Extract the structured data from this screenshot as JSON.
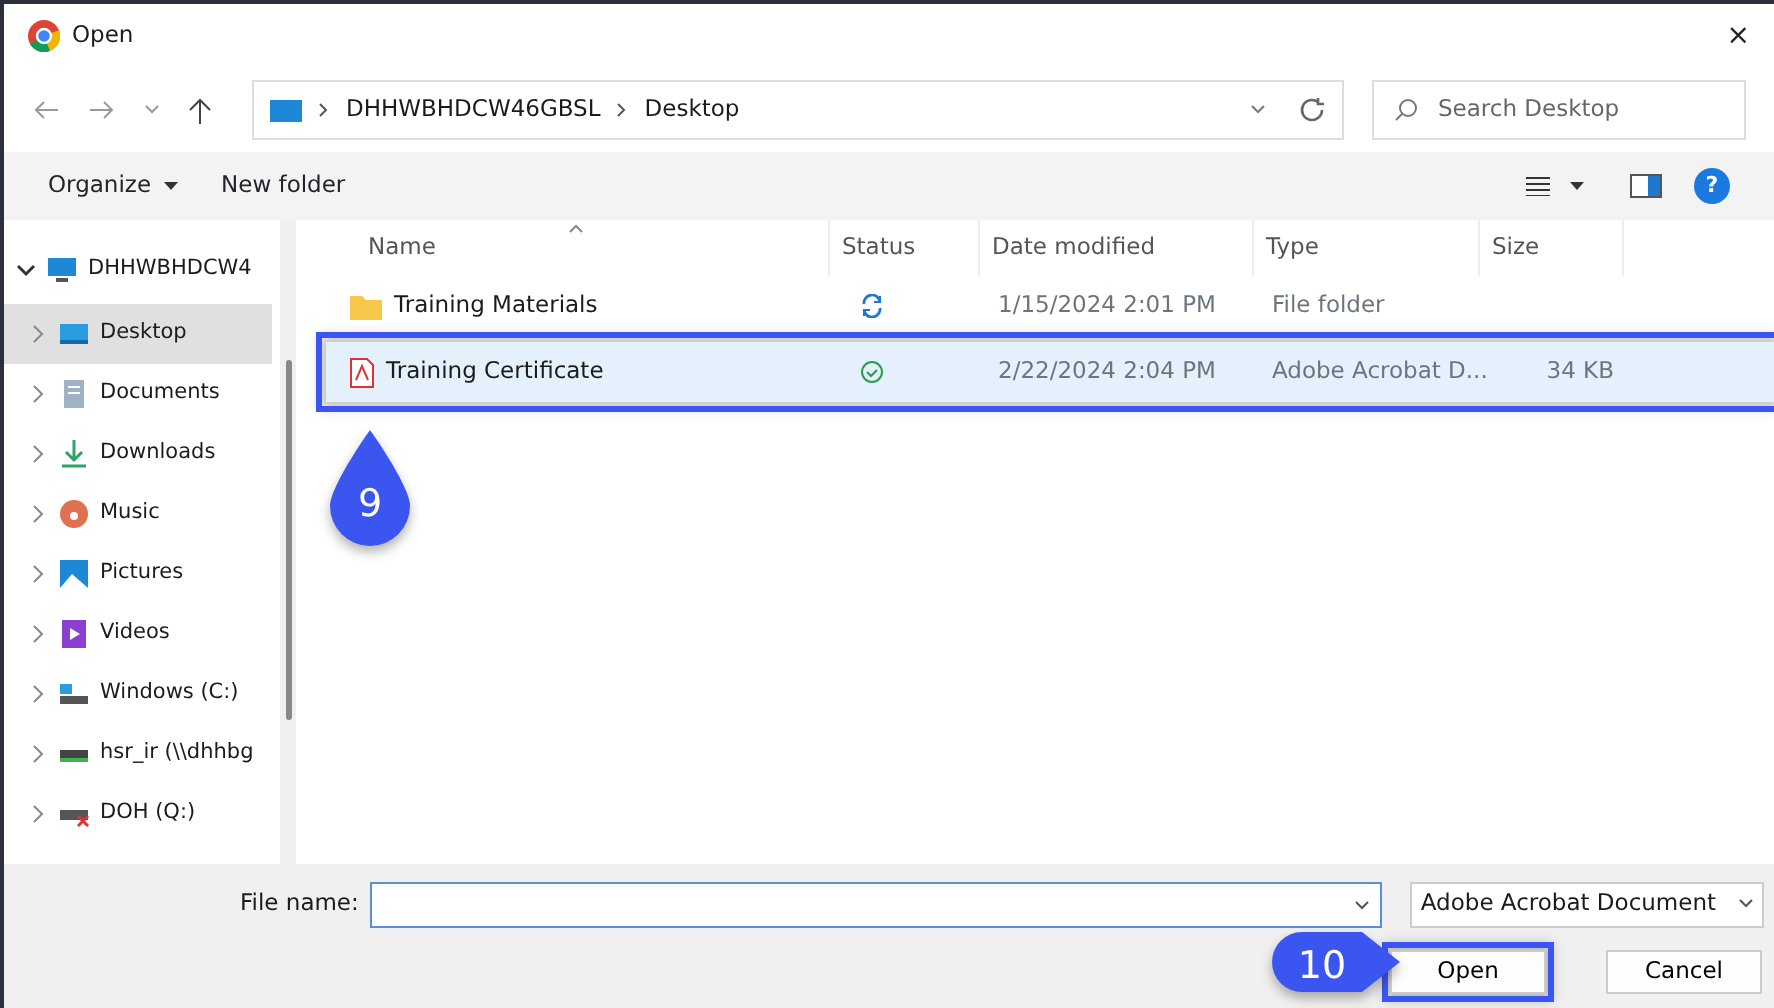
{
  "window": {
    "title": "Open",
    "close": "×"
  },
  "address": {
    "segments": [
      "DHHWBHDCW46GBSL",
      "Desktop"
    ]
  },
  "search": {
    "placeholder": "Search Desktop"
  },
  "toolbar": {
    "organize": "Organize",
    "new_folder": "New folder",
    "help": "?"
  },
  "sidebar": {
    "items": [
      {
        "label": "DHHWBHDCW4",
        "kind": "computer",
        "expanded": true,
        "selected": false
      },
      {
        "label": "Desktop",
        "kind": "desktop",
        "expanded": false,
        "selected": true
      },
      {
        "label": "Documents",
        "kind": "documents",
        "expanded": false,
        "selected": false
      },
      {
        "label": "Downloads",
        "kind": "downloads",
        "expanded": false,
        "selected": false
      },
      {
        "label": "Music",
        "kind": "music",
        "expanded": false,
        "selected": false
      },
      {
        "label": "Pictures",
        "kind": "pictures",
        "expanded": false,
        "selected": false
      },
      {
        "label": "Videos",
        "kind": "videos",
        "expanded": false,
        "selected": false
      },
      {
        "label": "Windows (C:)",
        "kind": "drive",
        "expanded": false,
        "selected": false
      },
      {
        "label": "hsr_ir (\\\\dhhbg",
        "kind": "network",
        "expanded": false,
        "selected": false
      },
      {
        "label": "DOH (Q:)",
        "kind": "netdrive",
        "expanded": false,
        "selected": false
      }
    ]
  },
  "table": {
    "columns": [
      "Name",
      "Status",
      "Date modified",
      "Type",
      "Size"
    ],
    "rows": [
      {
        "name": "Training Materials",
        "kind": "folder",
        "status": {
          "kind": "sync"
        },
        "date": "1/15/2024 2:01 PM",
        "type": "File folder",
        "selected": false,
        "highlighted": false
      },
      {
        "name": "Training Certificate",
        "kind": "pdf",
        "status": {
          "kind": "ok"
        },
        "date": "2/22/2024 2:04 PM",
        "type": "Adobe Acrobat D...",
        "size": "34 KB",
        "selected": true,
        "highlighted": true
      }
    ]
  },
  "footer": {
    "file_name_label": "File name:",
    "file_type": "Adobe Acrobat Document",
    "buttons": [
      {
        "label": "Open",
        "highlighted": true
      },
      {
        "label": "Cancel",
        "highlighted": false
      }
    ]
  },
  "callouts": [
    {
      "label": "9",
      "kind": "drop"
    },
    {
      "label": "10",
      "kind": "arrow"
    }
  ]
}
